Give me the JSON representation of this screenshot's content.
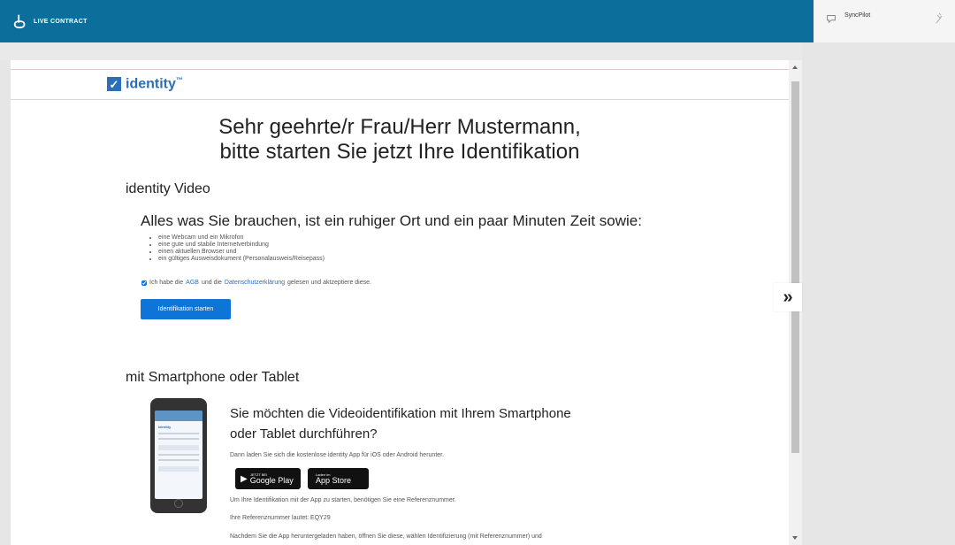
{
  "app": {
    "brand_name": "LIVE CONTRACT",
    "sync_label": "SyncPilot"
  },
  "viewer": {
    "logo_text": "identity",
    "logo_tm": "™",
    "greeting_line1": "Sehr geehrte/r Frau/Herr Mustermann,",
    "greeting_line2": "bitte starten Sie jetzt Ihre Identifikation",
    "video_title": "identity Video",
    "needs_heading": "Alles was Sie brauchen, ist ein ruhiger Ort und ein paar Minuten Zeit sowie:",
    "requirements": [
      "eine Webcam und ein Mikrofon",
      "eine gute und stabile Internetverbindung",
      "einen aktuellen Browser und",
      "ein gültiges Ausweisdokument (Personalausweis/Reisepass)"
    ],
    "agree_prefix": "Ich habe die",
    "agree_agb": "AGB",
    "agree_and": "und die",
    "agree_privacy": "Datenschutzerklärung",
    "agree_suffix": "gelesen und aktzeptiere diese.",
    "agree_checked": true,
    "start_button": "Identifikation starten",
    "smartphone_title": "mit Smartphone oder Tablet",
    "smartphone_heading_line1": "Sie möchten die Videoidentifikation mit Ihrem Smartphone",
    "smartphone_heading_line2": "oder Tablet durchführen?",
    "download_text": "Dann laden Sie sich die kostenlose identity App für iOS oder Android herunter.",
    "google_small": "JETZT BEI",
    "google_big": "Google Play",
    "apple_small": "Laden im",
    "apple_big": "App Store",
    "reference_info": "Um Ihre Identifikation mit der App zu starten, benötigen Sie eine Referenznummer.",
    "reference_number": "Ihre Referenznummer lautet: EQY29",
    "after_download": "Nachdem Sie die App heruntergeladen haben, öffnen Sie diese, wählen Identifizierung (mit Referenznummer) und"
  },
  "expand_toggle": "»",
  "colors": {
    "topbar": "#0c6f9b",
    "accent": "#2a6fb8",
    "button": "#0f74d8"
  }
}
